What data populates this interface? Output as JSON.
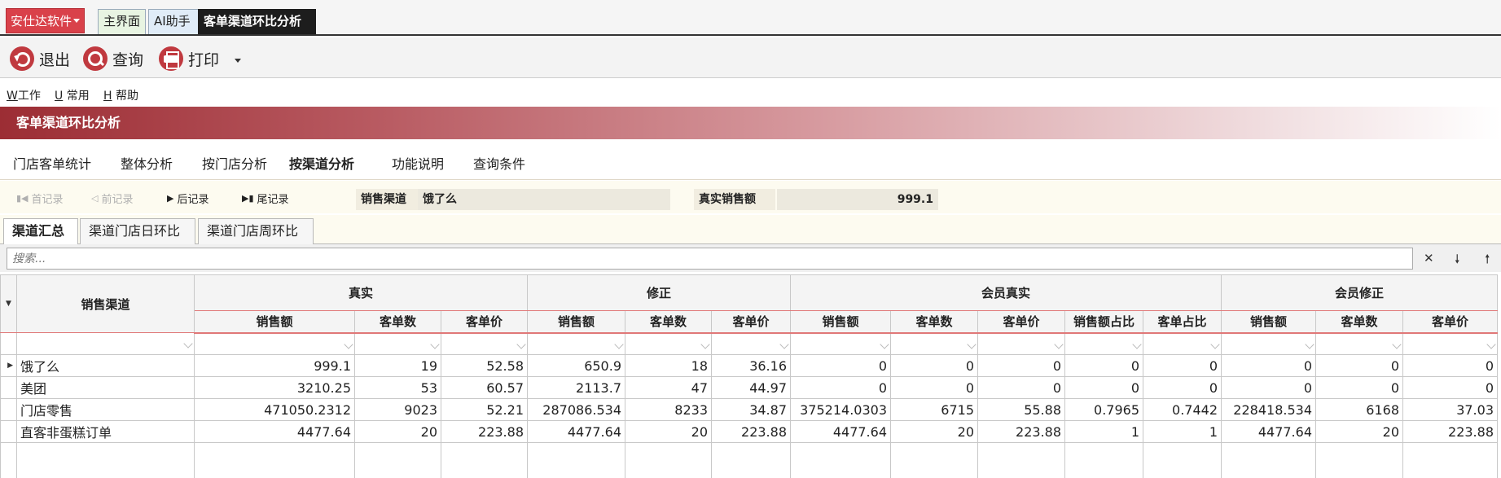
{
  "app": {
    "brand": "安仕达软件",
    "tabs": [
      {
        "label": "主界面"
      },
      {
        "label": "AI助手"
      },
      {
        "label": "客单渠道环比分析"
      }
    ]
  },
  "toolbar": {
    "exit_label": "退出",
    "query_label": "查询",
    "print_label": "打印"
  },
  "menu": [
    {
      "key": "W",
      "label": "工作"
    },
    {
      "key": "U",
      "label": "常用"
    },
    {
      "key": "H",
      "label": "帮助"
    }
  ],
  "banner": {
    "title": "客单渠道环比分析"
  },
  "subnav": [
    {
      "label": "门店客单统计"
    },
    {
      "label": "整体分析"
    },
    {
      "label": "按门店分析"
    },
    {
      "label": "按渠道分析"
    },
    {
      "label": "功能说明"
    },
    {
      "label": "查询条件"
    }
  ],
  "recordnav": {
    "first": "首记录",
    "prev": "前记录",
    "next": "后记录",
    "last": "尾记录",
    "channel_label": "销售渠道",
    "channel_value": "饿了么",
    "sales_label": "真实销售额",
    "sales_value": "999.1"
  },
  "content_tabs": [
    {
      "label": "渠道汇总"
    },
    {
      "label": "渠道门店日环比"
    },
    {
      "label": "渠道门店周环比"
    }
  ],
  "search": {
    "placeholder": "搜索..."
  },
  "table": {
    "first_col": "销售渠道",
    "groups": [
      {
        "label": "真实"
      },
      {
        "label": "修正"
      },
      {
        "label": "会员真实"
      },
      {
        "label": "会员修正"
      }
    ],
    "sub": {
      "sales": "销售额",
      "count": "客单数",
      "price": "客单价",
      "sales_ratio": "销售额占比",
      "count_ratio": "客单占比"
    },
    "rows": [
      {
        "name": "饿了么",
        "cells": [
          "999.1",
          "19",
          "52.58",
          "650.9",
          "18",
          "36.16",
          "0",
          "0",
          "0",
          "0",
          "0",
          "0",
          "0",
          "0"
        ]
      },
      {
        "name": "美团",
        "cells": [
          "3210.25",
          "53",
          "60.57",
          "2113.7",
          "47",
          "44.97",
          "0",
          "0",
          "0",
          "0",
          "0",
          "0",
          "0",
          "0"
        ]
      },
      {
        "name": "门店零售",
        "cells": [
          "471050.2312",
          "9023",
          "52.21",
          "287086.534",
          "8233",
          "34.87",
          "375214.0303",
          "6715",
          "55.88",
          "0.7965",
          "0.7442",
          "228418.534",
          "6168",
          "37.03"
        ]
      },
      {
        "name": "直客非蛋糕订单",
        "cells": [
          "4477.64",
          "20",
          "223.88",
          "4477.64",
          "20",
          "223.88",
          "4477.64",
          "20",
          "223.88",
          "1",
          "1",
          "4477.64",
          "20",
          "223.88"
        ]
      }
    ]
  }
}
